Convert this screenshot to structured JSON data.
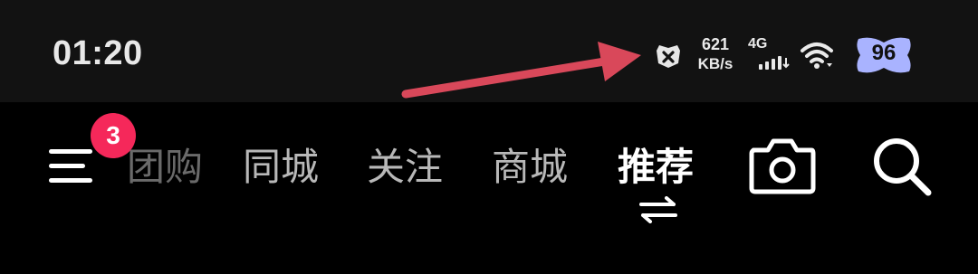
{
  "status_bar": {
    "time": "01:20",
    "net_speed_value": "621",
    "net_speed_unit": "KB/s",
    "network_type": "4G",
    "battery_level": "96",
    "battery_color": "#a9b3ff",
    "icons": [
      "notification-alert-icon",
      "signal-icon",
      "wifi-icon",
      "battery-icon"
    ]
  },
  "annotation": {
    "arrow_color": "#d9485a"
  },
  "nav": {
    "menu_badge": "3",
    "badge_color": "#f5285a",
    "tabs": [
      {
        "label": "团购"
      },
      {
        "label": "同城"
      },
      {
        "label": "关注"
      },
      {
        "label": "商城"
      },
      {
        "label": "推荐"
      }
    ],
    "active_tab": "推荐",
    "icons": [
      "menu-icon",
      "switch-icon",
      "camera-icon",
      "search-icon"
    ]
  }
}
